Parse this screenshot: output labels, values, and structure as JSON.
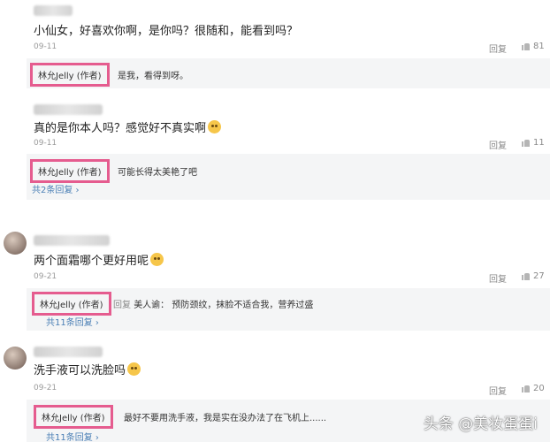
{
  "comments": [
    {
      "text": "小仙女，好喜欢你啊，是你吗？很随和，能看到吗？",
      "date": "09-11",
      "reply_label": "回复",
      "likes": "81",
      "author_reply": {
        "author": "林允Jelly (作者)",
        "text": "是我，看得到呀。"
      }
    },
    {
      "text": "真的是你本人吗？感觉好不真实啊",
      "date": "09-11",
      "reply_label": "回复",
      "likes": "11",
      "author_reply": {
        "author": "林允Jelly (作者)",
        "text": "可能长得太美艳了吧",
        "more": "共2条回复 ›"
      }
    },
    {
      "text": "两个面霜哪个更好用呢",
      "date": "09-21",
      "reply_label": "回复",
      "likes": "27",
      "author_reply": {
        "author": "林允Jelly (作者)",
        "prefix": "回复",
        "target": "美人谕：",
        "text": "预防颈纹，抹脸不适合我，营养过盛",
        "more": "共11条回复 ›"
      }
    },
    {
      "text": "洗手液可以洗脸吗",
      "date": "09-21",
      "reply_label": "回复",
      "likes": "20",
      "author_reply": {
        "author": "林允Jelly (作者)",
        "text": "最好不要用洗手液，我是实在没办法了在飞机上......",
        "more": "共11条回复 ›"
      }
    }
  ],
  "watermark": "头条 @美妆蛋蛋i",
  "colors": {
    "highlight_border": "#e55c8f",
    "link": "#4a7fb5",
    "reply_bg": "#f4f5f6"
  }
}
